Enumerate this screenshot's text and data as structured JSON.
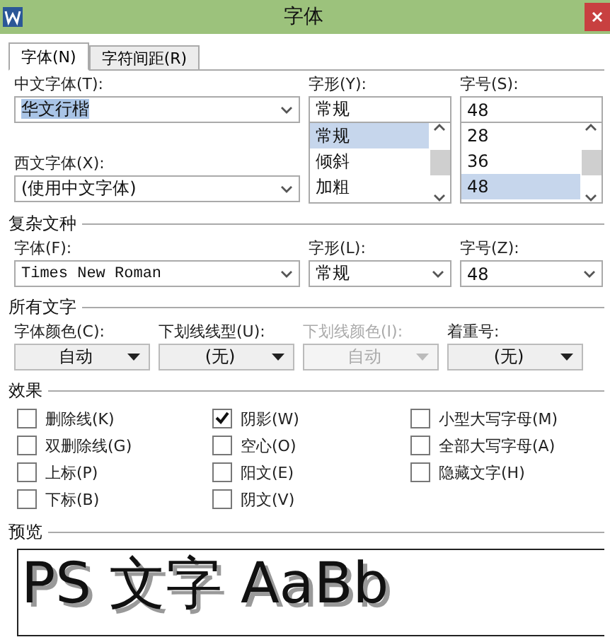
{
  "window": {
    "title": "字体"
  },
  "tabs": [
    {
      "label": "字体(N)",
      "selected": true
    },
    {
      "label": "字符间距(R)",
      "selected": false
    }
  ],
  "chinese_font": {
    "label": "中文字体(T):",
    "value": "华文行楷",
    "value_selected": true
  },
  "western_font": {
    "label": "西文字体(X):",
    "value": "(使用中文字体)"
  },
  "style": {
    "label": "字形(Y):",
    "value": "常规",
    "options": [
      {
        "label": "常规",
        "selected": true
      },
      {
        "label": "倾斜",
        "selected": false
      },
      {
        "label": "加粗",
        "selected": false
      }
    ]
  },
  "size": {
    "label": "字号(S):",
    "value": "48",
    "options": [
      {
        "label": "28",
        "selected": false
      },
      {
        "label": "36",
        "selected": false
      },
      {
        "label": "48",
        "selected": true
      }
    ]
  },
  "complex": {
    "title": "复杂文种",
    "fields": [
      {
        "label": "字体(F):",
        "value": "Times New Roman"
      },
      {
        "label": "字形(L):",
        "value": "常规"
      },
      {
        "label": "字号(Z):",
        "value": "48"
      }
    ]
  },
  "all_text": {
    "title": "所有文字",
    "dropdowns": [
      {
        "label": "字体颜色(C):",
        "value": "自动",
        "disabled": false
      },
      {
        "label": "下划线线型(U):",
        "value": "(无)",
        "disabled": false
      },
      {
        "label": "下划线颜色(I):",
        "value": "自动",
        "disabled": true
      },
      {
        "label": "着重号:",
        "value": "(无)",
        "disabled": false
      }
    ]
  },
  "effects": {
    "title": "效果",
    "columns": [
      [
        {
          "label": "删除线(K)",
          "checked": false
        },
        {
          "label": "双删除线(G)",
          "checked": false
        },
        {
          "label": "上标(P)",
          "checked": false
        },
        {
          "label": "下标(B)",
          "checked": false
        }
      ],
      [
        {
          "label": "阴影(W)",
          "checked": true
        },
        {
          "label": "空心(O)",
          "checked": false
        },
        {
          "label": "阳文(E)",
          "checked": false
        },
        {
          "label": "阴文(V)",
          "checked": false
        }
      ],
      [
        {
          "label": "小型大写字母(M)",
          "checked": false
        },
        {
          "label": "全部大写字母(A)",
          "checked": false
        },
        {
          "label": "隐藏文字(H)",
          "checked": false
        }
      ]
    ]
  },
  "preview": {
    "title": "预览",
    "text": "PS 文字 AaBb"
  }
}
